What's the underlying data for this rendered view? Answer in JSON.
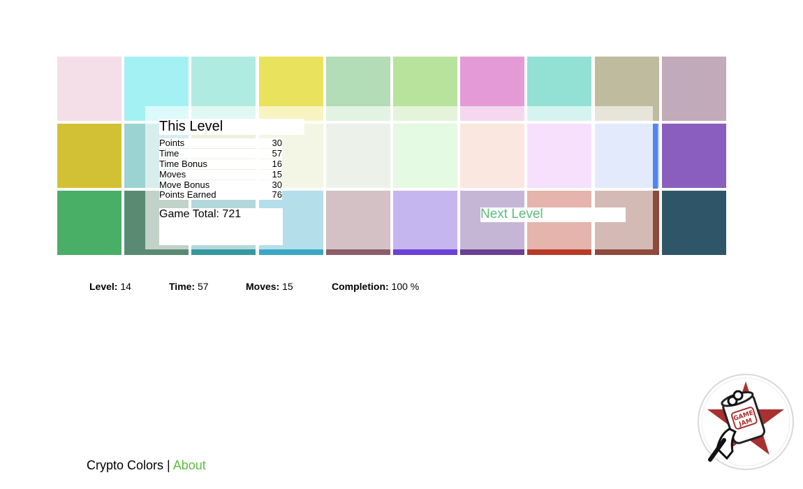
{
  "board": {
    "rows": [
      [
        "#f4dfe8",
        "#a4f1f4",
        "#b0ebe2",
        "#e9e25c",
        "#b3ddb6",
        "#b8e39d",
        "#e49ad7",
        "#92e1d4",
        "#bfbb9e",
        "#c1aab9"
      ],
      [
        "#d3c135",
        "#9ad3d2",
        "#cdd9a4",
        "#dfe7b9",
        "#cddcc7",
        "#b9f1b2",
        "#f1bfab",
        "#e6aff7",
        "#b6c8f4",
        "#8a5ebe"
      ],
      [
        "#49ae66",
        "#5a8a72",
        "#3598a0",
        "#3aa8c5",
        "#8b5e68",
        "#6b40d4",
        "#6b3f93",
        "#b73b28",
        "#8e4a3d",
        "#2f5668"
      ]
    ],
    "overlay_right_strip_color": "#4f86ee"
  },
  "summary": {
    "title": "This Level",
    "stats": [
      {
        "label": "Points",
        "value": "30"
      },
      {
        "label": "Time",
        "value": "57"
      },
      {
        "label": "Time Bonus",
        "value": "16"
      },
      {
        "label": "Moves",
        "value": "15"
      },
      {
        "label": "Move Bonus",
        "value": "30"
      },
      {
        "label": "Points Earned",
        "value": "76"
      }
    ],
    "game_total": "Game Total: 721",
    "next_level": "Next Level"
  },
  "status": {
    "level_label": "Level:",
    "level_value": "14",
    "time_label": "Time:",
    "time_value": "57",
    "moves_label": "Moves:",
    "moves_value": "15",
    "completion_label": "Completion:",
    "completion_value": "100 %"
  },
  "footer": {
    "app_name": "Crypto Colors",
    "separator": "|",
    "about_link": "About"
  },
  "logo": {
    "icon": "game-jam-logo-icon",
    "text_line1": "GAME",
    "text_line2": "JAM",
    "accent_color": "#a83030"
  }
}
